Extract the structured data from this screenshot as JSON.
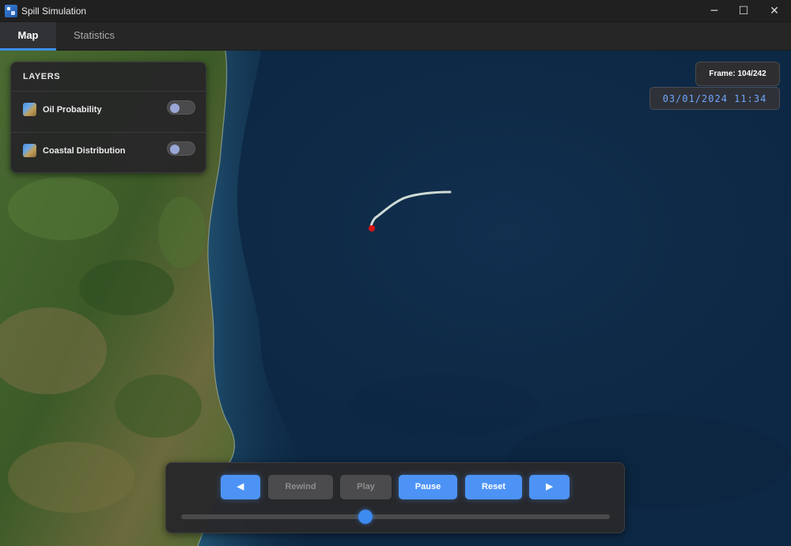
{
  "window": {
    "title": "Spill Simulation",
    "minimize_glyph": "─",
    "maximize_glyph": "☐",
    "close_glyph": "✕"
  },
  "tabs": [
    {
      "label": "Map",
      "active": true
    },
    {
      "label": "Statistics",
      "active": false
    }
  ],
  "layers_panel": {
    "title": "LAYERS",
    "items": [
      {
        "label": "Oil Probability",
        "enabled": false
      },
      {
        "label": "Coastal Distribution",
        "enabled": false
      }
    ]
  },
  "frame": {
    "label": "Frame: 104/242",
    "current": 104,
    "total": 242
  },
  "datetime": "03/01/2024 11:34",
  "controls": {
    "prev_glyph": "◀",
    "rewind_label": "Rewind",
    "play_label": "Play",
    "pause_label": "Pause",
    "reset_label": "Reset",
    "next_glyph": "▶",
    "rewind_enabled": false,
    "play_enabled": false,
    "slider_fraction": 0.43
  },
  "colors": {
    "accent": "#4d93f6",
    "ocean": "#0d2844",
    "land": "#3f5e2a",
    "spill_trail": "#e6eee6",
    "spill_head": "#d81414",
    "datetime_text": "#6ea7ff"
  }
}
